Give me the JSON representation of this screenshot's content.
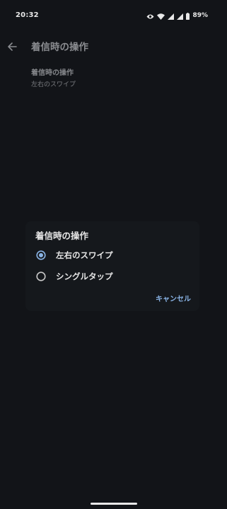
{
  "status_bar": {
    "time": "20:32",
    "battery": "89%",
    "icons": [
      "eye-icon",
      "wifi-icon",
      "signal-icon",
      "signal-icon",
      "battery-icon"
    ]
  },
  "app_bar": {
    "title": "着信時の操作",
    "back_icon": "arrow-left-icon"
  },
  "preference": {
    "title": "着信時の操作",
    "summary": "左右のスワイプ"
  },
  "dialog": {
    "title": "着信時の操作",
    "options": [
      {
        "label": "左右のスワイプ",
        "selected": true
      },
      {
        "label": "シングルタップ",
        "selected": false
      }
    ],
    "cancel_label": "キャンセル"
  },
  "colors": {
    "background": "#121418",
    "dialog_background": "#15181c",
    "accent": "#8ab4e6",
    "text_primary": "#e8e8e8",
    "text_dimmed": "#85878b"
  }
}
